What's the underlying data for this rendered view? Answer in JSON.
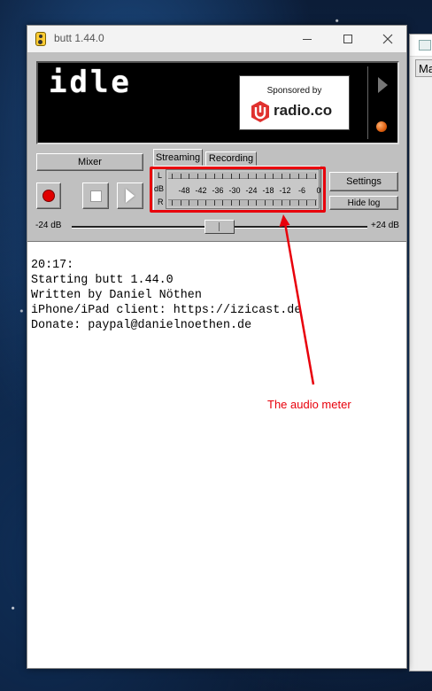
{
  "window": {
    "title": "butt 1.44.0"
  },
  "display": {
    "status": "idle",
    "sponsor_label": "Sponsored by",
    "sponsor_name": "radio.co"
  },
  "controls": {
    "mixer_label": "Mixer",
    "settings_label": "Settings",
    "hide_log_label": "Hide log"
  },
  "tabs": [
    {
      "label": "Streaming",
      "active": true
    },
    {
      "label": "Recording",
      "active": false
    }
  ],
  "meter": {
    "channel_left": "L",
    "channel_right": "R",
    "unit": "dB",
    "scale": [
      "-48",
      "-42",
      "-36",
      "-30",
      "-24",
      "-18",
      "-12",
      "-6",
      "0"
    ]
  },
  "gain_slider": {
    "min_label": "-24 dB",
    "max_label": "+24 dB",
    "value_db": 0
  },
  "log": {
    "lines": [
      "20:17:",
      "Starting butt 1.44.0",
      "Written by Daniel Nöthen",
      "iPhone/iPad client: https://izicast.de",
      "Donate: paypal@danielnoethen.de"
    ]
  },
  "annotation": {
    "label": "The audio meter",
    "color": "#e8000b"
  },
  "background_window": {
    "tab_text": "Ma"
  },
  "colors": {
    "record": "#e00000",
    "orange_indicator": "#e06010",
    "radio_co_brand": "#e0312e"
  }
}
